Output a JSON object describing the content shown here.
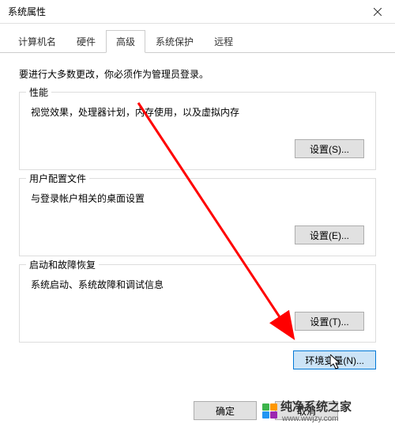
{
  "window": {
    "title": "系统属性"
  },
  "tabs": {
    "computer_name": "计算机名",
    "hardware": "硬件",
    "advanced": "高级",
    "system_protection": "系统保护",
    "remote": "远程"
  },
  "intro_text": "要进行大多数更改，你必须作为管理员登录。",
  "sections": {
    "performance": {
      "title": "性能",
      "desc": "视觉效果，处理器计划，内存使用，以及虚拟内存",
      "button": "设置(S)..."
    },
    "profiles": {
      "title": "用户配置文件",
      "desc": "与登录帐户相关的桌面设置",
      "button": "设置(E)..."
    },
    "startup": {
      "title": "启动和故障恢复",
      "desc": "系统启动、系统故障和调试信息",
      "button": "设置(T)..."
    }
  },
  "env_button": "环境变量(N)...",
  "bottom": {
    "ok": "确定",
    "cancel": "取消"
  },
  "watermark": {
    "brand": "纯净系统之家",
    "url": "www.wwjzy.com",
    "colors": {
      "tl": "#3cb44b",
      "tr": "#ff9800",
      "bl": "#2196f3",
      "br": "#9c27b0"
    }
  }
}
